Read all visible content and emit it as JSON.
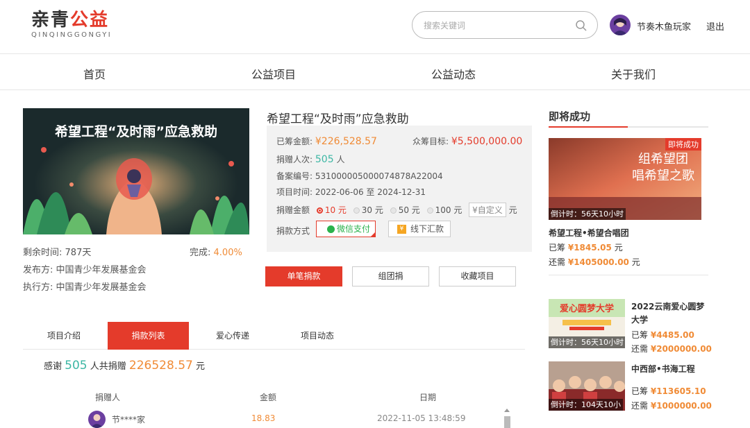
{
  "header": {
    "logo_text_1": "亲",
    "logo_text_2": "青",
    "logo_text_3": "公益",
    "logo_sub": "QINQINGGONGYI",
    "search_placeholder": "搜索关键词",
    "username": "节奏木鱼玩家",
    "logout": "退出"
  },
  "nav": [
    "首页",
    "公益项目",
    "公益动态",
    "关于我们"
  ],
  "project": {
    "image_text": "希望工程“及时雨”应急救助",
    "remaining_label": "剩余时间:",
    "remaining_value": "787天",
    "complete_label": "完成:",
    "complete_value": "4.00%",
    "publisher_label": "发布方:",
    "publisher": "中国青少年发展基金会",
    "executor_label": "执行方:",
    "executor": "中国青少年发展基金会",
    "title": "希望工程“及时雨”应急救助",
    "raised_label": "已筹金额:",
    "raised": "¥226,528.57",
    "goal_label": "众筹目标:",
    "goal": "¥5,500,000.00",
    "donors_label": "捐赠人次:",
    "donors": "505",
    "donors_unit": "人",
    "record_label": "备案编号:",
    "record": "53100000500007487​8A22004",
    "time_label": "项目时间:",
    "time": "2022-06-06 至 2024-12-31",
    "amount_label": "捐赠金额",
    "amount_options": [
      "10 元",
      "30 元",
      "50 元",
      "100 元"
    ],
    "custom_label": "¥自定义",
    "custom_unit": "元",
    "method_label": "捐款方式",
    "method_wechat": "微信支付",
    "method_offline": "线下汇款",
    "btn_single": "单笔捐款",
    "btn_group": "组团捐",
    "btn_favorite": "收藏项目"
  },
  "tabs": [
    "项目介绍",
    "捐款列表",
    "爱心传递",
    "项目动态"
  ],
  "donations": {
    "thanks_prefix": "感谢",
    "count": "505",
    "mid": "人共捐赠",
    "total": "226528.57",
    "unit": "元",
    "columns": [
      "捐赠人",
      "金额",
      "日期"
    ],
    "rows": [
      {
        "name": "节****家",
        "amount": "18.83",
        "date": "2022-11-05 13:48:59"
      }
    ]
  },
  "sidebar": {
    "title": "即将成功",
    "featured": {
      "badge": "即将成功",
      "image_text_1": "组希望团",
      "image_text_2": "唱希望之歌",
      "countdown": "倒计时：56天10小时",
      "name": "希望工程•希望合唱团",
      "raised_prefix": "已筹",
      "raised": "¥1845.05",
      "raised_unit": "元",
      "need_prefix": "还需",
      "need": "¥1405000.00",
      "need_unit": "元"
    },
    "items": [
      {
        "name": "2022云南爱心圆梦大学",
        "image_text": "爱心圆梦大学",
        "countdown": "倒计时：56天10小时",
        "raised_prefix": "已筹",
        "raised": "¥4485.00",
        "need_prefix": "还需",
        "need": "¥2000000.00"
      },
      {
        "name": "中西部•书海工程",
        "countdown": "倒计时：104天10小",
        "raised_prefix": "已筹",
        "raised": "¥113605.10",
        "need_prefix": "还需",
        "need": "¥1000000.00"
      }
    ]
  },
  "colors": {
    "accent": "#e43b2b",
    "orange": "#f08b36",
    "teal": "#3cb7a4"
  }
}
